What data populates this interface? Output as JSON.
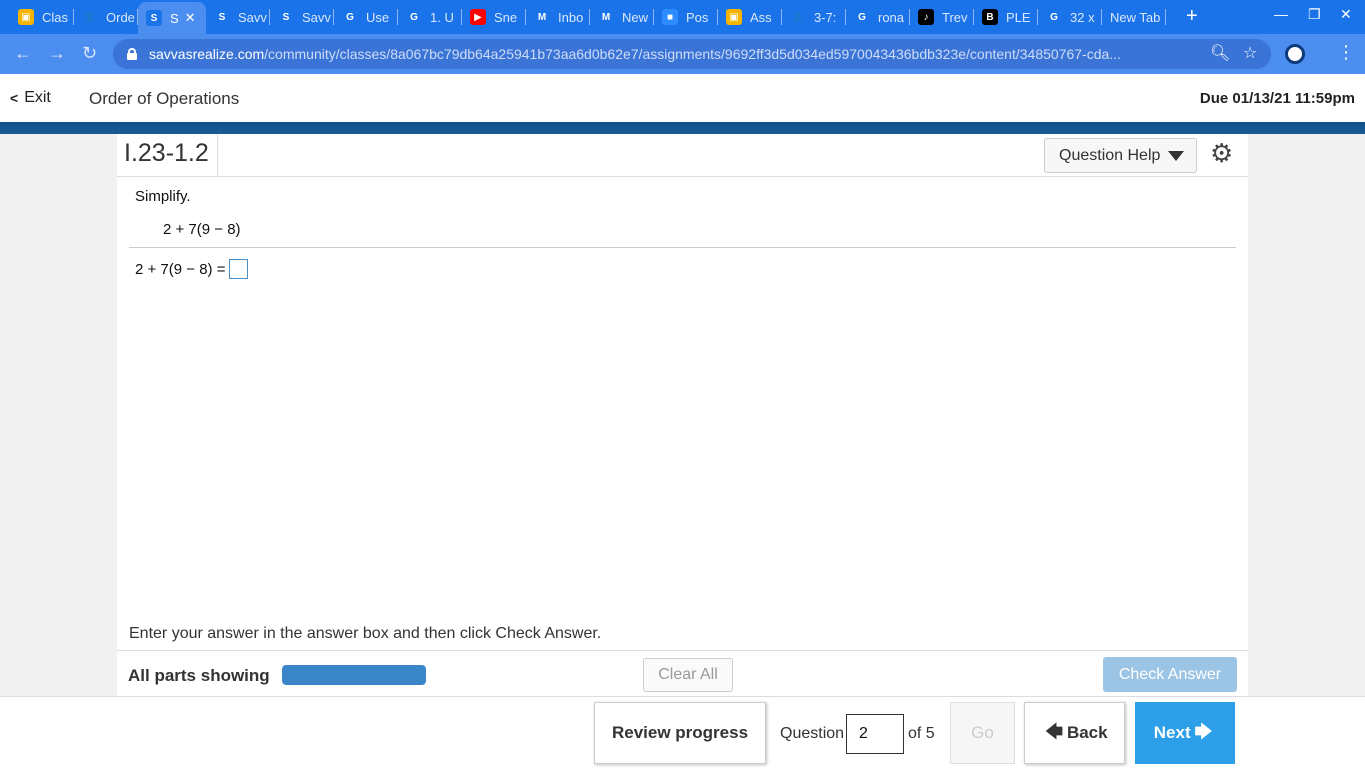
{
  "browser": {
    "tabs": [
      {
        "label": "Clas",
        "color": "#f4b400",
        "glyph": "▣"
      },
      {
        "label": "Orde",
        "color": "#1a73e8",
        "glyph": "👤"
      },
      {
        "label": "S",
        "color": "#1a73e8",
        "glyph": "S",
        "active": true
      },
      {
        "label": "Savv",
        "color": "#1a73e8",
        "glyph": "S"
      },
      {
        "label": "Savv",
        "color": "#1a73e8",
        "glyph": "S"
      },
      {
        "label": "Use",
        "color": "#ffffff",
        "glyph": "G"
      },
      {
        "label": "1. U",
        "color": "#ffffff",
        "glyph": "G"
      },
      {
        "label": "Sne",
        "color": "#ff0000",
        "glyph": "▶"
      },
      {
        "label": "Inbo",
        "color": "#ffffff",
        "glyph": "M"
      },
      {
        "label": "New",
        "color": "#ffffff",
        "glyph": "M"
      },
      {
        "label": "Pos",
        "color": "#2d8cff",
        "glyph": "■"
      },
      {
        "label": "Ass",
        "color": "#f4b400",
        "glyph": "▣"
      },
      {
        "label": "3-7:",
        "color": "#1a73e8",
        "glyph": "👤"
      },
      {
        "label": "rona",
        "color": "#ffffff",
        "glyph": "G"
      },
      {
        "label": "Trev",
        "color": "#000000",
        "glyph": "♪"
      },
      {
        "label": "PLE",
        "color": "#000000",
        "glyph": "B"
      },
      {
        "label": "32 x",
        "color": "#ffffff",
        "glyph": "G"
      },
      {
        "label": "New Tab",
        "color": "",
        "glyph": ""
      }
    ],
    "url_host": "savvasrealize.com",
    "url_path": "/community/classes/8a067bc79db64a25941b73aa6d0b62e7/assignments/9692ff3d5d034ed5970043436bdb323e/content/34850767-cda..."
  },
  "header": {
    "exit_label": "Exit",
    "title": "Order of Operations",
    "due": "Due 01/13/21 11:59pm"
  },
  "question": {
    "id": "I.23-1.2",
    "help_label": "Question Help",
    "instruction": "Simplify.",
    "expression": "2 + 7(9 − 8)",
    "answer_prefix": "2 + 7(9 − 8) =",
    "answer_value": ""
  },
  "footer": {
    "hint": "Enter your answer in the answer box and then click Check Answer.",
    "parts_label": "All parts showing",
    "progress_fraction": 1.0,
    "clear_all_label": "Clear All",
    "check_answer_label": "Check Answer"
  },
  "nav": {
    "review_label": "Review progress",
    "question_label": "Question",
    "question_value": "2",
    "of_total": "of 5",
    "go_label": "Go",
    "back_label": "Back",
    "next_label": "Next"
  },
  "colors": {
    "brand_blue": "#1a73e8",
    "band": "#0e4f8a",
    "next_button": "#2d9ee8",
    "check_answer": "#9cc4e4",
    "progress_fill": "#3a86c8"
  }
}
